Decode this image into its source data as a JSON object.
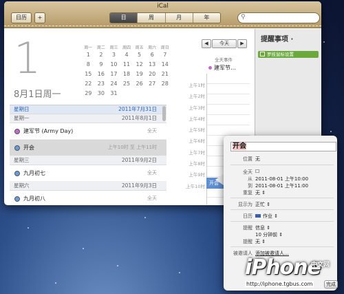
{
  "window": {
    "title": "iCal"
  },
  "toolbar": {
    "calendars_label": "日历",
    "add_label": "+",
    "views": [
      "日",
      "周",
      "月",
      "年"
    ],
    "active_view": "日",
    "search_placeholder": ""
  },
  "day_header": {
    "big_day": "1",
    "date_text": "8月1日周一"
  },
  "mini_calendar": {
    "weekday_headers": [
      "周一",
      "周二",
      "周三",
      "周四",
      "周五",
      "周六",
      "周日"
    ],
    "weeks": [
      [
        "1",
        "2",
        "3",
        "4",
        "5",
        "6",
        "7"
      ],
      [
        "8",
        "9",
        "10",
        "11",
        "12",
        "13",
        "14"
      ],
      [
        "15",
        "16",
        "17",
        "18",
        "19",
        "20",
        "21"
      ],
      [
        "22",
        "23",
        "24",
        "25",
        "26",
        "27",
        "28"
      ],
      [
        "29",
        "30",
        "31",
        "",
        "",
        "",
        ""
      ]
    ]
  },
  "event_list": {
    "sections": [
      {
        "weekday": "星期日",
        "date": "2011年7月31日"
      },
      {
        "weekday": "星期一",
        "date": "2011年8月1日"
      },
      {
        "weekday": "星期三",
        "date": "2011年9月2日"
      },
      {
        "weekday": "星期六",
        "date": "2011年9月3日"
      }
    ],
    "events": [
      {
        "title": "建军节 (Army Day)",
        "time": "全天",
        "color": "#c06ccb"
      },
      {
        "title": "开会",
        "time": "上午10时 至 上午11时",
        "color": "#6e9ad8"
      },
      {
        "title": "九月初七",
        "time": "全天",
        "color": "#6e9ad8"
      },
      {
        "title": "九月初八",
        "time": "全天",
        "color": "#6e9ad8"
      }
    ]
  },
  "day_view": {
    "prev_label": "◀",
    "next_label": "▶",
    "today_label": "今天",
    "allday_label": "全天事件",
    "allday_event": "建军节…",
    "hours": [
      "上午1时",
      "上午2时",
      "上午3时",
      "上午4时",
      "上午5时",
      "上午6时",
      "上午7时",
      "上午8时",
      "上午9时",
      "上午10时"
    ],
    "block_event": "开会"
  },
  "reminders": {
    "title": "提醒事项 ·",
    "item": "罗技鼠标设置",
    "item_color": "#6aaa3c"
  },
  "popover": {
    "title": "开会",
    "location_label": "位置",
    "location_value": "无",
    "allday_label": "全天",
    "allday_value": "☐",
    "from_label": "从",
    "from_value": "2011-08-01 上午10:00",
    "to_label": "到",
    "to_value": "2011-08-01 上午11:00",
    "repeat_label": "重复",
    "repeat_value": "无 ⇕",
    "show_as_label": "显示为",
    "show_as_value": "正忙 ⇕",
    "calendar_label": "日历",
    "calendar_value": "作业 ⇕",
    "calendar_color": "#3b5fa8",
    "alert_label": "提醒",
    "alert_value_1": "信息 ⇕",
    "alert_value_2": "10 分钟前 ⇕",
    "alert2_label": "提醒",
    "alert2_value": "无 ⇕",
    "invitees_label": "被邀请人",
    "invitees_link": "添加被邀请人…",
    "done_label": "完成"
  },
  "watermark": {
    "brand": "iPhone",
    "cn": "中文网",
    "url": "http://iphone.tgbus.com"
  }
}
